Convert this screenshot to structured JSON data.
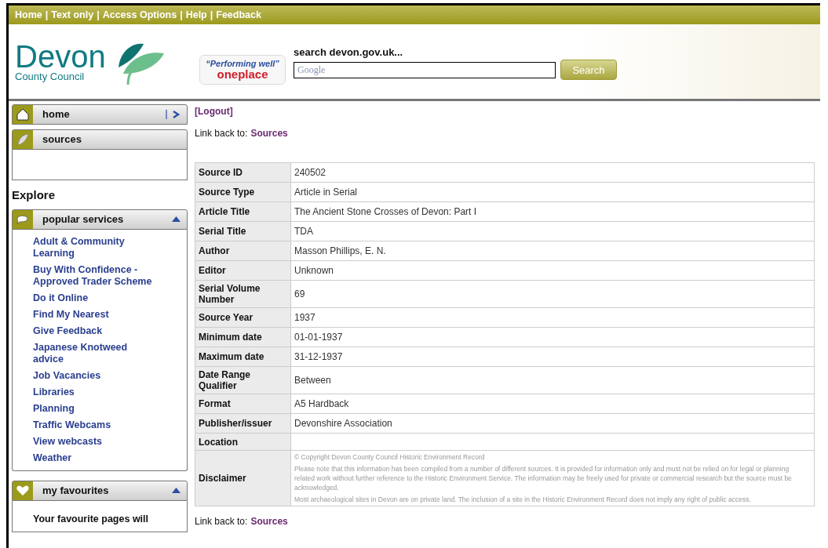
{
  "top_links": [
    "Home",
    "Text only",
    "Access Options",
    "Help",
    "Feedback"
  ],
  "top_separator": "|",
  "logo": {
    "name": "Devon",
    "subtitle": "County Council"
  },
  "badge": {
    "tagline": "“Performing well”",
    "brand": "oneplace"
  },
  "search": {
    "label": "search devon.gov.uk...",
    "placeholder": "Google",
    "button": "Search"
  },
  "sidebar": {
    "nav": [
      {
        "label": "home",
        "arrow": true
      },
      {
        "label": "sources",
        "arrow": false
      }
    ],
    "explore_heading": "Explore",
    "popular": {
      "title": "popular services",
      "expanded": true,
      "links": [
        "Adult & Community Learning",
        "Buy With Confidence - Approved Trader Scheme",
        "Do it Online",
        "Find My Nearest",
        "Give Feedback",
        "Japanese Knotweed advice",
        "Job Vacancies",
        "Libraries",
        "Planning",
        "Traffic Webcams",
        "View webcasts",
        "Weather"
      ]
    },
    "favourites": {
      "title": "my favourites",
      "expanded": true,
      "text": "Your favourite pages will"
    }
  },
  "content": {
    "logout": "[Logout]",
    "back_label": "Link back to:",
    "back_link": "Sources",
    "rows": [
      {
        "label": "Source ID",
        "value": "240502"
      },
      {
        "label": "Source Type",
        "value": "Article in Serial"
      },
      {
        "label": "Article Title",
        "value": "The Ancient Stone Crosses of Devon: Part I"
      },
      {
        "label": "Serial Title",
        "value": "TDA"
      },
      {
        "label": "Author",
        "value": "Masson Phillips, E. N."
      },
      {
        "label": "Editor",
        "value": "Unknown"
      },
      {
        "label": "Serial Volume Number",
        "value": "69"
      },
      {
        "label": "Source Year",
        "value": "1937"
      },
      {
        "label": "Minimum date",
        "value": "01-01-1937"
      },
      {
        "label": "Maximum date",
        "value": "31-12-1937"
      },
      {
        "label": "Date Range Qualifier",
        "value": "Between"
      },
      {
        "label": "Format",
        "value": "A5 Hardback"
      },
      {
        "label": "Publisher/issuer",
        "value": "Devonshire Association"
      },
      {
        "label": "Location",
        "value": ""
      }
    ],
    "disclaimer": {
      "label": "Disclaimer",
      "paragraphs": [
        "© Copyright Devon County Council Historic Environment Record",
        "Please note that this information has been compiled from a number of different sources. It is provided for information only and must not be relied on for legal or planning related work without further reference to the Historic Environment Service. The information may be freely used for private or commercial research but the source must be acknowledged.",
        "Most archaeological sites in Devon are on private land. The inclusion of a site in the Historic Environment Record does not imply any right of public access."
      ]
    },
    "back_label_2": "Link back to:",
    "back_link_2": "Sources"
  }
}
